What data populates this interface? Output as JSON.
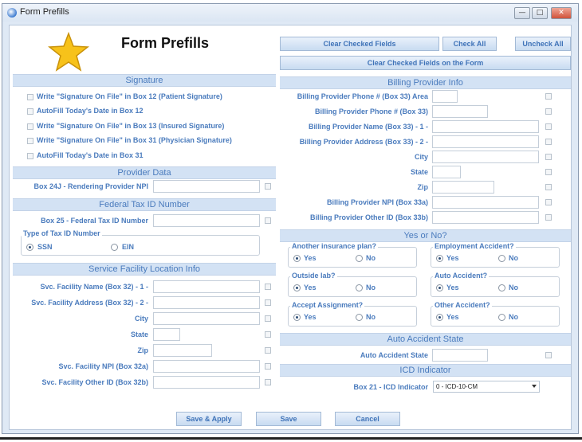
{
  "window": {
    "title": "Form Prefills",
    "controls": {
      "minimize": "—",
      "maximize": "□",
      "close": "✕"
    }
  },
  "header": {
    "title": "Form Prefills",
    "icon": "star-icon"
  },
  "top_buttons": {
    "clear_checked": "Clear Checked Fields",
    "check_all": "Check All",
    "uncheck_all": "Uncheck All",
    "clear_on_form": "Clear Checked Fields on the Form"
  },
  "signature": {
    "title": "Signature",
    "items": [
      "Write \"Signature On File\" in Box 12 (Patient Signature)",
      "AutoFill Today's Date in Box 12",
      "Write \"Signature On File\" in Box 13 (Insured Signature)",
      "Write \"Signature On File\" in Box 31 (Physician Signature)",
      "AutoFill Today's Date in Box 31"
    ]
  },
  "provider_data": {
    "title": "Provider Data",
    "rendering_npi_label": "Box 24J - Rendering Provider NPI",
    "rendering_npi_value": ""
  },
  "federal_tax": {
    "title": "Federal Tax ID Number",
    "number_label": "Box 25 - Federal Tax ID Number",
    "number_value": "",
    "type_legend": "Type of Tax ID Number",
    "options": [
      "SSN",
      "EIN"
    ],
    "selected": "SSN"
  },
  "service_facility": {
    "title": "Service Facility Location Info",
    "fields": [
      {
        "label": "Svc. Facility Name (Box 32) - 1 -",
        "value": ""
      },
      {
        "label": "Svc. Facility Address (Box 32) - 2 -",
        "value": ""
      },
      {
        "label": "City",
        "value": ""
      },
      {
        "label": "State",
        "value": ""
      },
      {
        "label": "Zip",
        "value": ""
      },
      {
        "label": "Svc. Facility NPI (Box 32a)",
        "value": ""
      },
      {
        "label": "Svc. Facility Other ID (Box 32b)",
        "value": ""
      }
    ]
  },
  "billing_provider": {
    "title": "Billing Provider Info",
    "fields": [
      {
        "label": "Billing Provider Phone # (Box 33) Area",
        "value": ""
      },
      {
        "label": "Billing Provider Phone # (Box 33)",
        "value": ""
      },
      {
        "label": "Billing Provider Name (Box 33) - 1 -",
        "value": ""
      },
      {
        "label": "Billing Provider Address (Box 33) - 2 -",
        "value": ""
      },
      {
        "label": "City",
        "value": ""
      },
      {
        "label": "State",
        "value": ""
      },
      {
        "label": "Zip",
        "value": ""
      },
      {
        "label": "Billing Provider NPI (Box 33a)",
        "value": ""
      },
      {
        "label": "Billing Provider Other ID (Box 33b)",
        "value": ""
      }
    ]
  },
  "yes_no": {
    "title": "Yes or No?",
    "yes_label": "Yes",
    "no_label": "No",
    "groups": [
      {
        "legend": "Another insurance plan?",
        "selected": "Yes"
      },
      {
        "legend": "Employment Accident?",
        "selected": "Yes"
      },
      {
        "legend": "Outside lab?",
        "selected": "Yes"
      },
      {
        "legend": "Auto Accident?",
        "selected": "Yes"
      },
      {
        "legend": "Accept Assignment?",
        "selected": "Yes"
      },
      {
        "legend": "Other Accident?",
        "selected": "Yes"
      }
    ]
  },
  "auto_accident": {
    "title": "Auto Accident State",
    "label": "Auto Accident State",
    "value": ""
  },
  "icd": {
    "title": "ICD Indicator",
    "label": "Box 21 - ICD Indicator",
    "selected": "0 - ICD-10-CM"
  },
  "footer": {
    "save_apply": "Save & Apply",
    "save": "Save",
    "cancel": "Cancel"
  }
}
